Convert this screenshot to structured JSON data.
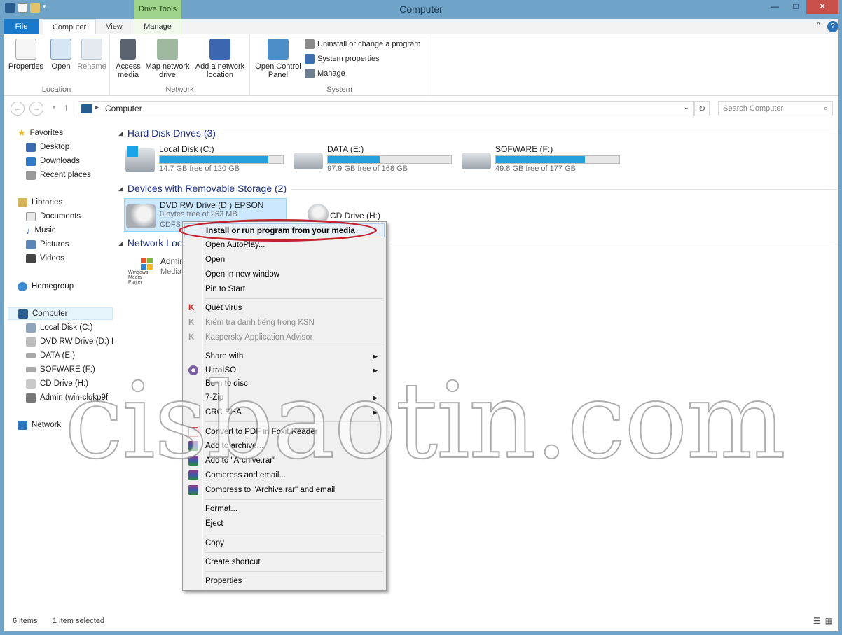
{
  "window": {
    "title": "Computer",
    "contextual_tab_group": "Drive Tools"
  },
  "ribbon_tabs": [
    "File",
    "Computer",
    "View",
    "Manage"
  ],
  "ribbon": {
    "location": {
      "label": "Location",
      "properties": "Properties",
      "open": "Open",
      "rename": "Rename"
    },
    "network": {
      "label": "Network",
      "access_media": "Access media",
      "map_network_drive": "Map network drive",
      "add_network_location": "Add a network location"
    },
    "system": {
      "label": "System",
      "open_control_panel": "Open Control Panel",
      "uninstall": "Uninstall or change a program",
      "system_properties": "System properties",
      "manage": "Manage"
    }
  },
  "address": {
    "crumb": "Computer",
    "search_placeholder": "Search Computer"
  },
  "navpane": {
    "favorites": "Favorites",
    "desktop": "Desktop",
    "downloads": "Downloads",
    "recent": "Recent places",
    "libraries": "Libraries",
    "documents": "Documents",
    "music": "Music",
    "pictures": "Pictures",
    "videos": "Videos",
    "homegroup": "Homegroup",
    "computer": "Computer",
    "local_disk": "Local Disk (C:)",
    "dvd": "DVD RW Drive (D:) EF",
    "data": "DATA (E:)",
    "sofware": "SOFWARE (F:)",
    "cd": "CD Drive (H:)",
    "admin": "Admin (win-clqkp9f",
    "network": "Network"
  },
  "sections": {
    "hard_disks": "Hard Disk Drives (3)",
    "removable": "Devices with Removable Storage (2)",
    "network_loc": "Network Loca"
  },
  "drives": {
    "c": {
      "name": "Local Disk (C:)",
      "free": "14.7 GB free of 120 GB",
      "used_fraction": 0.88
    },
    "e": {
      "name": "DATA (E:)",
      "free": "97.9 GB free of 168 GB",
      "used_fraction": 0.42
    },
    "f": {
      "name": "SOFWARE (F:)",
      "free": "49.8 GB free of 177 GB",
      "used_fraction": 0.72
    },
    "d": {
      "name": "DVD RW Drive (D:) EPSON",
      "free": "0 bytes free of 263 MB",
      "fs": "CDFS"
    },
    "h": {
      "name": "CD Drive (H:)"
    },
    "admin": {
      "name": "Admin",
      "sub": "Media",
      "logo": "Windows Media Player"
    }
  },
  "context_menu": {
    "install": "Install or run program from your media",
    "autoplay": "Open AutoPlay...",
    "open": "Open",
    "open_new_window": "Open in new window",
    "pin_start": "Pin to Start",
    "quet_virus": "Quét virus",
    "kiem_tra": "Kiểm tra danh tiếng trong KSN",
    "kaspersky": "Kaspersky Application Advisor",
    "share_with": "Share with",
    "ultraiso": "UltraISO",
    "burn": "Burn to disc",
    "zip": "7-Zip",
    "crc": "CRC SHA",
    "convert_pdf": "Convert to PDF in Foxit Reader",
    "add_archive": "Add to archive...",
    "add_archive_rar": "Add to \"Archive.rar\"",
    "compress_email": "Compress and email...",
    "compress_rar_email": "Compress to \"Archive.rar\" and email",
    "format": "Format...",
    "eject": "Eject",
    "copy": "Copy",
    "create_shortcut": "Create shortcut",
    "properties": "Properties"
  },
  "status": {
    "items": "6 items",
    "selected": "1 item selected"
  },
  "watermark": "cisbaotin.com",
  "colors": {
    "title_bar": "#6fa3c8",
    "file_tab": "#1979ca",
    "drive_tools": "#9fd48a",
    "progress": "#26a0da",
    "highlight_ring": "#c41f2e"
  }
}
